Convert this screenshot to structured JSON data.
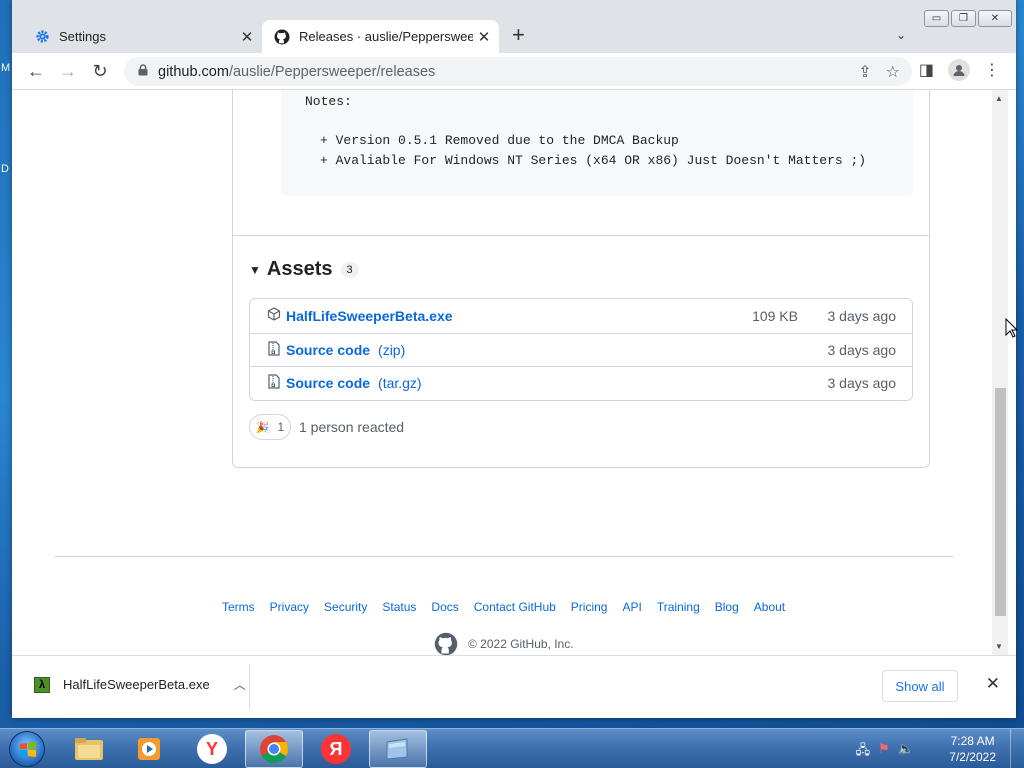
{
  "desktop": {
    "edge_letters": [
      "M",
      "D"
    ]
  },
  "browser": {
    "tabs": [
      {
        "title": "Settings",
        "icon": "gear-icon",
        "active": false
      },
      {
        "title": "Releases · auslie/Peppersweeper",
        "icon": "github-icon",
        "active": true
      }
    ],
    "address": {
      "host": "github.com",
      "path": "/auslie/Peppersweeper/releases"
    }
  },
  "release": {
    "notes_label": "Notes:",
    "notes_lines": [
      "+ Version 0.5.1 Removed due to the DMCA Backup",
      "+ Avaliable For Windows NT Series (x64 OR x86) Just Doesn't Matters ;)"
    ],
    "assets": {
      "title": "Assets",
      "count": "3",
      "items": [
        {
          "name": "HalfLifeSweeperBeta.exe",
          "ext": "",
          "size": "109 KB",
          "date": "3 days ago",
          "icon": "package-icon"
        },
        {
          "name": "Source code",
          "ext": "(zip)",
          "size": "",
          "date": "3 days ago",
          "icon": "file-zip-icon"
        },
        {
          "name": "Source code",
          "ext": "(tar.gz)",
          "size": "",
          "date": "3 days ago",
          "icon": "file-zip-icon"
        }
      ]
    },
    "reaction": {
      "count": "1",
      "text": "1 person reacted",
      "emoji": "tada-icon"
    }
  },
  "footer": {
    "links": [
      "Terms",
      "Privacy",
      "Security",
      "Status",
      "Docs",
      "Contact GitHub",
      "Pricing",
      "API",
      "Training",
      "Blog",
      "About"
    ],
    "copyright": "© 2022 GitHub, Inc."
  },
  "download_shelf": {
    "file_name": "HalfLifeSweeperBeta.exe",
    "show_all_label": "Show all"
  },
  "taskbar": {
    "time": "7:28 AM",
    "date": "7/2/2022",
    "yandex_letter": "Я"
  },
  "colors": {
    "link": "#0969da",
    "muted": "#57606a",
    "border": "#d0d7de"
  }
}
